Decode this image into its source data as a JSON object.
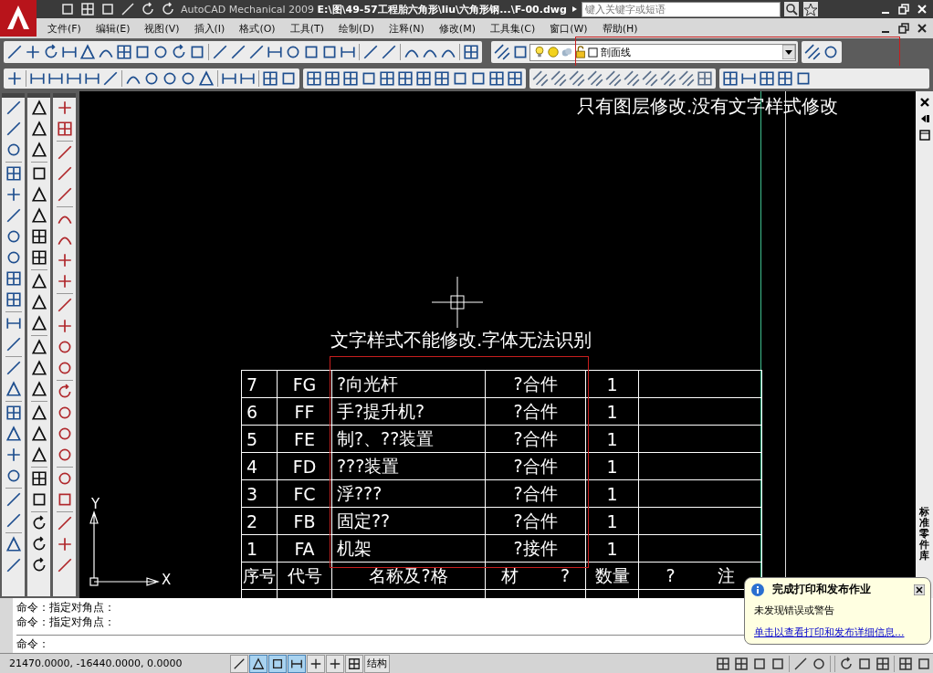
{
  "window": {
    "title": "AutoCAD Mechanical 2009 **E:\\图\\49-57工程胎六角形\\liu\\六角形钢...\\F-00.dwg**"
  },
  "search": {
    "placeholder": "键入关键字或短语"
  },
  "menu": [
    "文件(F)",
    "编辑(E)",
    "视图(V)",
    "插入(I)",
    "格式(O)",
    "工具(T)",
    "绘制(D)",
    "注释(N)",
    "修改(M)",
    "工具集(C)",
    "窗口(W)",
    "帮助(H)"
  ],
  "layer_control": {
    "value": "剖面线"
  },
  "drawing": {
    "notes": [
      "只有图层修改.没有文字样式修改",
      "文字样式不能修改.字体无法识别"
    ],
    "table": {
      "rows": [
        [
          "7",
          "FG",
          "?向光杆",
          "?合件",
          "1"
        ],
        [
          "6",
          "FF",
          "手?提升机?",
          "?合件",
          "1"
        ],
        [
          "5",
          "FE",
          "制?、??装置",
          "?合件",
          "1"
        ],
        [
          "4",
          "FD",
          "???装置",
          "?合件",
          "1"
        ],
        [
          "3",
          "FC",
          "浮???",
          "?合件",
          "1"
        ],
        [
          "2",
          "FB",
          "固定??",
          "?合件",
          "1"
        ],
        [
          "1",
          "FA",
          "机架",
          "?接件",
          "1"
        ]
      ],
      "header": [
        "序号",
        "代号",
        "名称及?格",
        "材 ?",
        "数量",
        "? 注"
      ]
    },
    "axis_labels": [
      "Y",
      "X"
    ]
  },
  "side_panel": {
    "title": "标准零件库"
  },
  "command_history": [
    "命令：指定对角点：",
    "命令：指定对角点："
  ],
  "command_prompt": "命令：",
  "status_bar": {
    "coordinates": "21470.0000, -16440.0000, 0.0000",
    "toggles": [
      {
        "on": false
      },
      {
        "on": true
      },
      {
        "on": true
      },
      {
        "on": true
      },
      {
        "on": false
      },
      {
        "on": false
      },
      {
        "on": false
      }
    ],
    "label": "结构"
  },
  "notification": {
    "title": "完成打印和发布作业",
    "message": "未发现错误或警告",
    "link": "单击以查看打印和发布详细信息..."
  }
}
